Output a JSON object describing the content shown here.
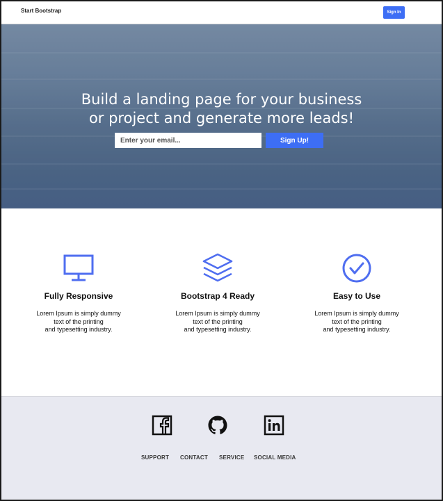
{
  "navbar": {
    "brand": "Start Bootstrap",
    "signin_label": "Sign In"
  },
  "hero": {
    "headline_line1": "Build a landing page for your business",
    "headline_line2": "or project and generate more leads!",
    "email_placeholder": "Enter your email...",
    "signup_label": "Sign Up!"
  },
  "features": [
    {
      "icon": "monitor-icon",
      "title": "Fully Responsive",
      "desc_line1": "Lorem Ipsum is simply dummy",
      "desc_line2": "text of the printing",
      "desc_line3": "and typesetting industry."
    },
    {
      "icon": "layers-icon",
      "title": "Bootstrap 4 Ready",
      "desc_line1": "Lorem Ipsum is simply dummy",
      "desc_line2": "text of the printing",
      "desc_line3": "and typesetting industry."
    },
    {
      "icon": "check-circle-icon",
      "title": "Easy to Use",
      "desc_line1": "Lorem Ipsum is simply dummy",
      "desc_line2": "text of the printing",
      "desc_line3": "and typesetting industry."
    }
  ],
  "footer": {
    "social": [
      "facebook-icon",
      "github-icon",
      "linkedin-icon"
    ],
    "links": [
      "SUPPORT",
      "CONTACT",
      "SERVICE",
      "SOCIAL MEDIA"
    ]
  },
  "colors": {
    "accent": "#3d6ef5",
    "icon": "#4f6ef0",
    "footer_bg": "#e8e9f1"
  }
}
